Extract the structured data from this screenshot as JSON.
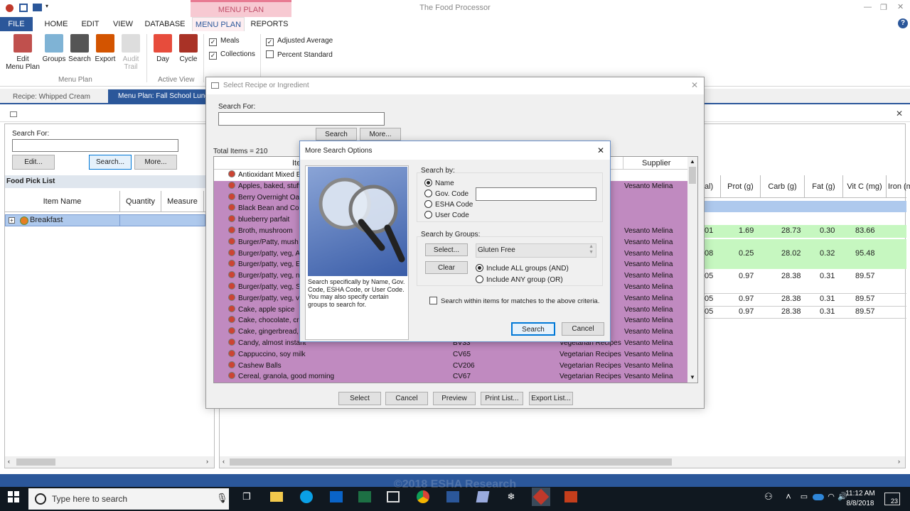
{
  "app": {
    "title": "The Food Processor",
    "context_tab": "MENU PLAN"
  },
  "ribbon": {
    "tabs": [
      "FILE",
      "HOME",
      "EDIT",
      "VIEW",
      "DATABASE",
      "MENU PLAN",
      "REPORTS"
    ],
    "buttons": {
      "edit_menu_plan": "Edit\nMenu Plan",
      "groups": "Groups",
      "search": "Search",
      "export": "Export",
      "audit_trail": "Audit\nTrail",
      "day": "Day",
      "cycle": "Cycle"
    },
    "group_menu_plan": "Menu Plan",
    "group_active_view": "Active View",
    "checks": {
      "meals": "Meals",
      "collections": "Collections",
      "adjusted_average": "Adjusted Average",
      "percent_standard": "Percent Standard"
    }
  },
  "doc_tabs": {
    "recipe": "Recipe: Whipped Cream",
    "menu_plan": "Menu Plan: Fall School Lunch"
  },
  "left_panel": {
    "search_for": "Search For:",
    "edit": "Edit...",
    "search": "Search...",
    "more": "More...",
    "pick_list_title": "Food Pick List",
    "columns": [
      "Item Name",
      "Quantity",
      "Measure"
    ],
    "breakfast": "Breakfast"
  },
  "bg_grid": {
    "columns": [
      "al)",
      "Prot (g)",
      "Carb (g)",
      "Fat (g)",
      "Vit C (mg)",
      "Iron (m"
    ],
    "rows": [
      {
        "a": "01",
        "prot": "1.69",
        "carb": "28.73",
        "fat": "0.30",
        "vitc": "83.66"
      },
      {
        "a": "08",
        "prot": "0.25",
        "carb": "28.02",
        "fat": "0.32",
        "vitc": "95.48"
      },
      {
        "a": "05",
        "prot": "0.97",
        "carb": "28.38",
        "fat": "0.31",
        "vitc": "89.57"
      },
      {
        "a": "05",
        "prot": "0.97",
        "carb": "28.38",
        "fat": "0.31",
        "vitc": "89.57"
      },
      {
        "a": "05",
        "prot": "0.97",
        "carb": "28.38",
        "fat": "0.31",
        "vitc": "89.57"
      }
    ]
  },
  "select_dialog": {
    "title": "Select Recipe or Ingredient",
    "search_for": "Search For:",
    "search": "Search",
    "more": "More...",
    "total_items": "Total Items = 210",
    "col_item": "Item",
    "col_supplier": "Supplier",
    "items": [
      {
        "name": "Antioxidant Mixed B",
        "code": "",
        "group": "",
        "supplier": ""
      },
      {
        "name": "Apples, baked, stuff",
        "code": "",
        "group": "",
        "supplier": "Vesanto Melina"
      },
      {
        "name": "Berry Overnight Oat",
        "code": "",
        "group": "",
        "supplier": ""
      },
      {
        "name": "Black Bean and Cor",
        "code": "",
        "group": "",
        "supplier": ""
      },
      {
        "name": "blueberry parfait",
        "code": "",
        "group": "",
        "supplier": ""
      },
      {
        "name": "Broth, mushroom",
        "code": "",
        "group": "",
        "supplier": "Vesanto Melina"
      },
      {
        "name": "Burger/Patty, mush",
        "code": "",
        "group": "",
        "supplier": "Vesanto Melina"
      },
      {
        "name": "Burger/patty, veg, A",
        "code": "",
        "group": "",
        "supplier": "Vesanto Melina"
      },
      {
        "name": "Burger/patty, veg, E",
        "code": "",
        "group": "",
        "supplier": "Vesanto Melina"
      },
      {
        "name": "Burger/patty, veg, n",
        "code": "",
        "group": "",
        "supplier": "Vesanto Melina"
      },
      {
        "name": "Burger/patty, veg, S",
        "code": "",
        "group": "",
        "supplier": "Vesanto Melina"
      },
      {
        "name": "Burger/patty, veg, v",
        "code": "",
        "group": "",
        "supplier": "Vesanto Melina"
      },
      {
        "name": "Cake, apple spice",
        "code": "",
        "group": "",
        "supplier": "Vesanto Melina"
      },
      {
        "name": "Cake, chocolate, cre",
        "code": "",
        "group": "",
        "supplier": "Vesanto Melina"
      },
      {
        "name": "Cake, gingerbread, l",
        "code": "",
        "group": "",
        "supplier": "Vesanto Melina"
      },
      {
        "name": "Candy, almost instant",
        "code": "BV33",
        "group": "Vegetarian Recipes",
        "supplier": "Vesanto Melina"
      },
      {
        "name": "Cappuccino, soy milk",
        "code": "CV65",
        "group": "Vegetarian Recipes",
        "supplier": "Vesanto Melina"
      },
      {
        "name": "Cashew Balls",
        "code": "CV206",
        "group": "Vegetarian Recipes",
        "supplier": "Vesanto Melina"
      },
      {
        "name": "Cereal, granola, good morning",
        "code": "CV67",
        "group": "Vegetarian Recipes",
        "supplier": "Vesanto Melina"
      }
    ],
    "buttons": {
      "select": "Select",
      "cancel": "Cancel",
      "preview": "Preview",
      "print_list": "Print List...",
      "export_list": "Export List..."
    }
  },
  "more_dialog": {
    "title": "More Search Options",
    "description": "Search specifically by Name, Gov. Code, ESHA Code, or User Code. You may also specify certain groups to search for.",
    "search_by": "Search by:",
    "options": [
      "Name",
      "Gov. Code",
      "ESHA Code",
      "User Code"
    ],
    "search_by_groups": "Search by Groups:",
    "select": "Select...",
    "clear": "Clear",
    "group_value": "Gluten Free",
    "include_all": "Include ALL groups (AND)",
    "include_any": "Include ANY group (OR)",
    "within": "Search within items for matches to the above criteria.",
    "search": "Search",
    "cancel": "Cancel"
  },
  "taskbar": {
    "search_placeholder": "Type here to search",
    "time": "11:12 AM",
    "date": "8/8/2018",
    "badge": "23",
    "watermark": "©2018 ESHA Research"
  },
  "colors": {
    "accent": "#2b579a",
    "pink": "#f4a9b8",
    "purple": "#c08ac0",
    "green": "#c6f7c0",
    "taskbar": "#101820"
  }
}
